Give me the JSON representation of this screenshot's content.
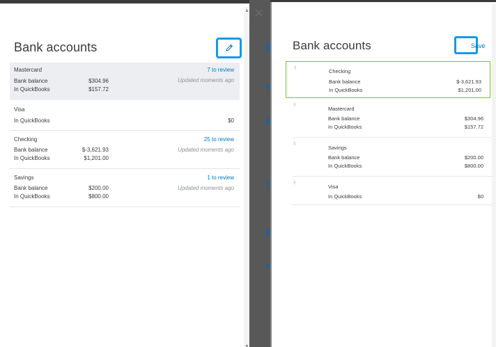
{
  "colors": {
    "accent": "#1598e8",
    "link": "#0077c5",
    "selected_border": "#7dc51b",
    "highlight_row": "#eceef1"
  },
  "icons": {
    "close": "close-icon",
    "edit": "pencil-icon",
    "drag": "drag-handle-icon"
  },
  "left_panel": {
    "title": "Bank accounts",
    "close_glyph": "×",
    "accounts": [
      {
        "name": "Mastercard",
        "bank_label": "Bank balance",
        "bank_value": "$304.96",
        "qb_label": "In QuickBooks",
        "qb_value": "$157.72",
        "review": "7 to review",
        "updated": "Updated moments ago"
      },
      {
        "name": "Visa",
        "qb_label": "In QuickBooks",
        "qb_value": "$0"
      },
      {
        "name": "Checking",
        "bank_label": "Bank balance",
        "bank_value": "$-3,621.93",
        "qb_label": "In QuickBooks",
        "qb_value": "$1,201.00",
        "review": "25 to review",
        "updated": "Updated moments ago"
      },
      {
        "name": "Savings",
        "bank_label": "Bank balance",
        "bank_value": "$200.00",
        "qb_label": "In QuickBooks",
        "qb_value": "$800.00",
        "review": "1 to review",
        "updated": "Updated moments ago"
      }
    ]
  },
  "right_panel": {
    "title": "Bank accounts",
    "save_label": "Save",
    "accounts": [
      {
        "name": "Checking",
        "bank_label": "Bank balance",
        "bank_value": "$-3,621.93",
        "qb_label": "In QuickBooks",
        "qb_value": "$1,201.00"
      },
      {
        "name": "Mastercard",
        "bank_label": "Bank balance",
        "bank_value": "$304.96",
        "qb_label": "In QuickBooks",
        "qb_value": "$157.72"
      },
      {
        "name": "Savings",
        "bank_label": "Bank balance",
        "bank_value": "$200.00",
        "qb_label": "In QuickBooks",
        "qb_value": "$800.00"
      },
      {
        "name": "Visa",
        "qb_label": "In QuickBooks",
        "qb_value": "$0"
      }
    ]
  }
}
